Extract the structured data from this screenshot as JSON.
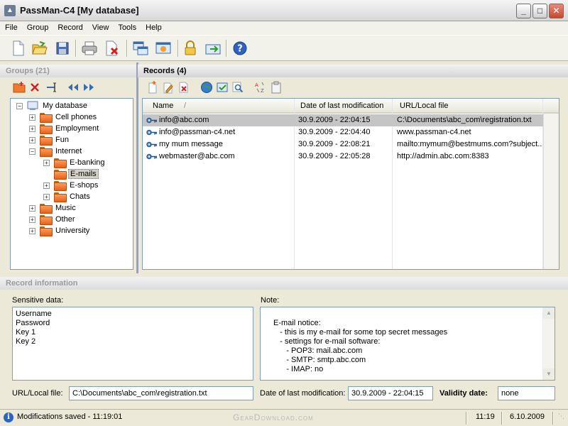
{
  "window": {
    "title": "PassMan-C4 [My database]"
  },
  "menu": [
    "File",
    "Group",
    "Record",
    "View",
    "Tools",
    "Help"
  ],
  "groups_panel": {
    "title": "Groups (21)"
  },
  "records_panel": {
    "title": "Records (4)"
  },
  "tree": {
    "root": "My database",
    "items": [
      {
        "label": "Cell phones",
        "level": 1,
        "expander": "+"
      },
      {
        "label": "Employment",
        "level": 1,
        "expander": "+"
      },
      {
        "label": "Fun",
        "level": 1,
        "expander": "+"
      },
      {
        "label": "Internet",
        "level": 1,
        "expander": "−"
      },
      {
        "label": "E-banking",
        "level": 2,
        "expander": "+"
      },
      {
        "label": "E-mails",
        "level": 2,
        "expander": "",
        "selected": true
      },
      {
        "label": "E-shops",
        "level": 2,
        "expander": "+"
      },
      {
        "label": "Chats",
        "level": 2,
        "expander": "+"
      },
      {
        "label": "Music",
        "level": 1,
        "expander": "+"
      },
      {
        "label": "Other",
        "level": 1,
        "expander": "+"
      },
      {
        "label": "University",
        "level": 1,
        "expander": "+"
      }
    ]
  },
  "records": {
    "columns": [
      "Name",
      "Date of last modification",
      "URL/Local file"
    ],
    "sort_indicator": "/",
    "rows": [
      {
        "name": "info@abc.com",
        "date": "30.9.2009 - 22:04:15",
        "url": "C:\\Documents\\abc_com\\registration.txt"
      },
      {
        "name": "info@passman-c4.net",
        "date": "30.9.2009 - 22:04:40",
        "url": "www.passman-c4.net"
      },
      {
        "name": "my mum message",
        "date": "30.9.2009 - 22:08:21",
        "url": "mailto:mymum@bestmums.com?subject..."
      },
      {
        "name": "webmaster@abc.com",
        "date": "30.9.2009 - 22:05:28",
        "url": "http://admin.abc.com:8383"
      }
    ]
  },
  "record_info": {
    "title": "Record information",
    "sensitive_label": "Sensitive data:",
    "sensitive_lines": [
      "Username",
      "Password",
      "Key 1",
      "Key 2"
    ],
    "note_label": "Note:",
    "note_lines": [
      "E-mail notice:",
      "   - this is my e-mail for some top secret messages",
      "   - settings for e-mail software:",
      "      - POP3: mail.abc.com",
      "      - SMTP: smtp.abc.com",
      "      - IMAP: no"
    ],
    "url_label": "URL/Local file:",
    "url_value": "C:\\Documents\\abc_com\\registration.txt",
    "date_label": "Date of last modification:",
    "date_value": "30.9.2009 - 22:04:15",
    "validity_label": "Validity date:",
    "validity_value": "none"
  },
  "status": {
    "message": "Modifications saved - 11:19:01",
    "time": "11:19",
    "date": "6.10.2009",
    "watermark": "GearDownload.com"
  },
  "colors": {
    "folder": "#f07a30",
    "selection": "#c5c5c5",
    "border": "#7f9db9"
  }
}
